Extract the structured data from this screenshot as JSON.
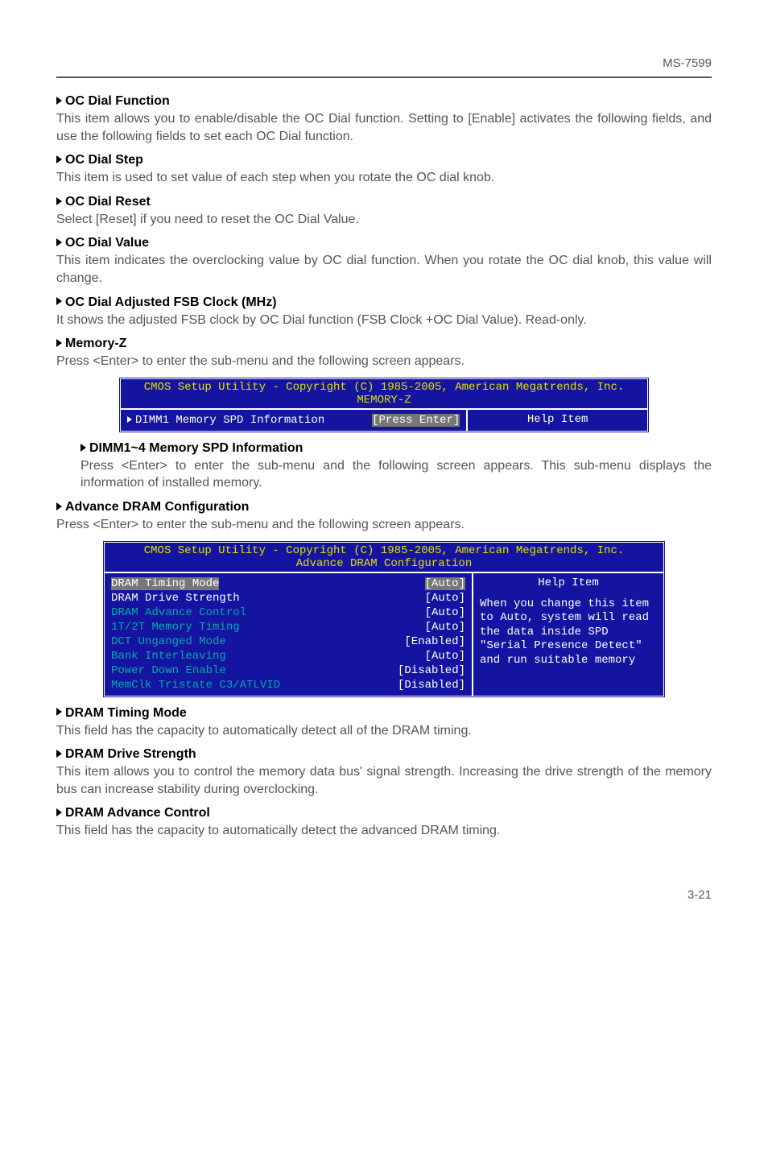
{
  "header": {
    "docnum": "MS-7599"
  },
  "sections": [
    {
      "title": "OC Dial Function",
      "text": "This item allows you to enable/disable the OC Dial function. Setting to [Enable] activates the following fields, and use the following fields to set each OC Dial function."
    },
    {
      "title": "OC Dial Step",
      "text": "This item is used to set value of each step when you rotate the OC dial knob."
    },
    {
      "title": "OC Dial Reset",
      "text": "Select [Reset] if you need to reset the OC Dial Value."
    },
    {
      "title": "OC Dial Value",
      "text": "This item indicates the overclocking value by OC dial function. When you rotate the OC dial knob, this value will change."
    },
    {
      "title": "OC Dial Adjusted FSB Clock (MHz)",
      "text": "It shows the adjusted FSB clock by OC Dial function (FSB Clock +OC Dial Value). Read-only."
    },
    {
      "title": "Memory-Z",
      "text": "Press <Enter> to enter the sub-menu and the following screen appears."
    }
  ],
  "bios1": {
    "line1": "CMOS Setup Utility - Copyright (C) 1985-2005, American Megatrends, Inc.",
    "line2": "MEMORY-Z",
    "row_label": "DIMM1 Memory SPD Information",
    "row_value": "[Press Enter]",
    "help_title": "Help Item"
  },
  "dimm_sub": {
    "title": "DIMM1~4 Memory SPD Information",
    "text": "Press <Enter> to enter the sub-menu and the following screen appears. This sub-menu displays the information of installed memory."
  },
  "adv_dram": {
    "title": "Advance DRAM Configuration",
    "text": "Press <Enter> to enter the sub-menu and the following screen appears."
  },
  "bios2": {
    "line1": "CMOS Setup Utility - Copyright (C) 1985-2005, American Megatrends, Inc.",
    "line2": "Advance DRAM Configuration",
    "rows": [
      {
        "label": "DRAM Timing Mode",
        "value": "[Auto]",
        "hl": true,
        "cyan": false
      },
      {
        "label": "DRAM Drive Strength",
        "value": "[Auto]",
        "hl": false,
        "cyan": false
      },
      {
        "label": "DRAM Advance Control",
        "value": "[Auto]",
        "hl": false,
        "cyan": true
      },
      {
        "label": "1T/2T Memory Timing",
        "value": "[Auto]",
        "hl": false,
        "cyan": true
      },
      {
        "label": "DCT Unganged Mode",
        "value": "[Enabled]",
        "hl": false,
        "cyan": true
      },
      {
        "label": "Bank Interleaving",
        "value": "[Auto]",
        "hl": false,
        "cyan": true
      },
      {
        "label": "Power Down Enable",
        "value": "[Disabled]",
        "hl": false,
        "cyan": true
      },
      {
        "label": "MemClk Tristate C3/ATLVID",
        "value": "[Disabled]",
        "hl": false,
        "cyan": true
      }
    ],
    "help_title": "Help Item",
    "help_body": "When you change this item to Auto, system will read the data inside SPD \"Serial Presence Detect\" and run suitable memory"
  },
  "tail_sections": [
    {
      "title": "DRAM Timing Mode",
      "text": "This field has the capacity to automatically detect all of the DRAM timing."
    },
    {
      "title": "DRAM Drive Strength",
      "text": "This item allows you to control the memory data bus' signal strength. Increasing the drive strength of the memory bus can increase stability during overclocking."
    },
    {
      "title": "DRAM Advance Control",
      "text": "This field has the capacity to automatically detect the advanced DRAM timing."
    }
  ],
  "page_num": "3-21"
}
